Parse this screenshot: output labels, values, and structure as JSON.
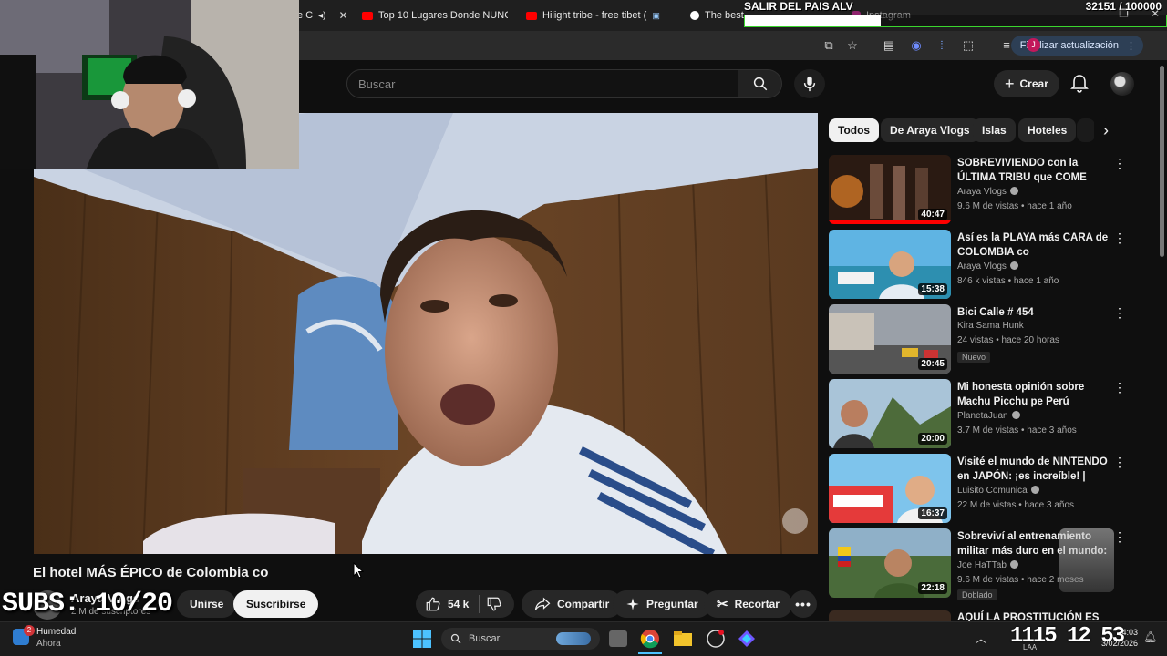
{
  "stream_overlay": {
    "goal_title": "SALIR DEL PAIS ALV",
    "goal_count": "32151 / 100000",
    "goal_progress": 0.3215,
    "subs_counter": "SUBS: 10/20",
    "clock_digits": "1115 12 53"
  },
  "browser": {
    "tabs": [
      {
        "label": "e C",
        "favicon": "youtube-icon",
        "active": true
      },
      {
        "label": "Top 10 Lugares Donde NUNC",
        "favicon": "youtube-icon",
        "active": false
      },
      {
        "label": "Hilight tribe - free tibet (",
        "favicon": "youtube-icon",
        "active": false
      },
      {
        "label": "The best",
        "favicon": "web-icon",
        "active": false
      },
      {
        "label": "Instagram",
        "favicon": "instagram-icon",
        "active": false
      }
    ],
    "update_button": "Finalizar actualización",
    "profile_initial": "J"
  },
  "youtube": {
    "search_placeholder": "Buscar",
    "create_label": "Crear",
    "video": {
      "title": "El hotel MÁS ÉPICO de Colombia co",
      "channel": "Araya Vlogs",
      "subscribers": "2 M de suscriptores",
      "join_label": "Unirse",
      "subscribe_label": "Suscribirse",
      "likes": "54 k",
      "share_label": "Compartir",
      "ask_label": "Preguntar",
      "clip_label": "Recortar"
    },
    "chips": [
      "Todos",
      "De Araya Vlogs",
      "Islas",
      "Hoteles"
    ],
    "recommendations": [
      {
        "title": "SOBREVIVIENDO con la ÚLTIMA TRIBU que COME HUMANOS | ...",
        "channel": "Araya Vlogs",
        "verified": true,
        "meta": "9.6 M de vistas • hace 1 año",
        "duration": "40:47"
      },
      {
        "title": "Así es la PLAYA más CARA de COLOMBIA co",
        "channel": "Araya Vlogs",
        "verified": true,
        "meta": "846 k vistas • hace 1 año",
        "duration": "15:38"
      },
      {
        "title": "Bici Calle # 454",
        "channel": "Kira Sama Hunk",
        "verified": false,
        "meta": "24 vistas • hace 20 horas",
        "duration": "20:45",
        "badge": "Nuevo"
      },
      {
        "title": "Mi honesta opinión sobre Machu Picchu pe Perú",
        "channel": "PlanetaJuan",
        "verified": true,
        "meta": "3.7 M de vistas • hace 3 años",
        "duration": "20:00"
      },
      {
        "title": "Visité el mundo de NINTENDO en JAPÓN: ¡es increíble! | Sup...",
        "channel": "Luisito Comunica",
        "verified": true,
        "meta": "22 M de vistas • hace 3 años",
        "duration": "16:37"
      },
      {
        "title": "Sobreviví al entrenamiento militar más duro en el mundo: ...",
        "channel": "Joe HaTTab",
        "verified": true,
        "meta": "9.6 M de vistas • hace 2 meses",
        "duration": "22:18",
        "badge": "Doblado"
      },
      {
        "title": "AQUÍ LA PROSTITUCIÓN ES",
        "channel": "",
        "verified": false,
        "meta": "",
        "duration": ""
      }
    ]
  },
  "taskbar": {
    "weather_label": "Humedad",
    "weather_time": "Ahora",
    "weather_badge": "2",
    "search_label": "Buscar",
    "lang": "LAA",
    "time": "4:03",
    "date": "3/02/2026"
  },
  "colors": {
    "background": "#0f0f0f",
    "surface": "#272727",
    "text": "#f1f1f1",
    "secondary_text": "#aaaaaa",
    "goal_border": "#3bd62e"
  }
}
